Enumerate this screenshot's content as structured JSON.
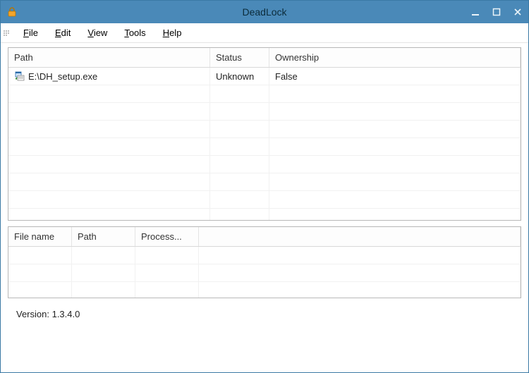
{
  "window": {
    "title": "DeadLock"
  },
  "menu": {
    "file": "File",
    "edit": "Edit",
    "view": "View",
    "tools": "Tools",
    "help": "Help"
  },
  "topGrid": {
    "headers": {
      "path": "Path",
      "status": "Status",
      "ownership": "Ownership"
    },
    "rows": [
      {
        "path": "E:\\DH_setup.exe",
        "status": "Unknown",
        "ownership": "False"
      }
    ]
  },
  "bottomGrid": {
    "headers": {
      "filename": "File name",
      "path": "Path",
      "process": "Process..."
    },
    "rows": []
  },
  "status": {
    "versionLabel": "Version: 1.3.4.0"
  }
}
